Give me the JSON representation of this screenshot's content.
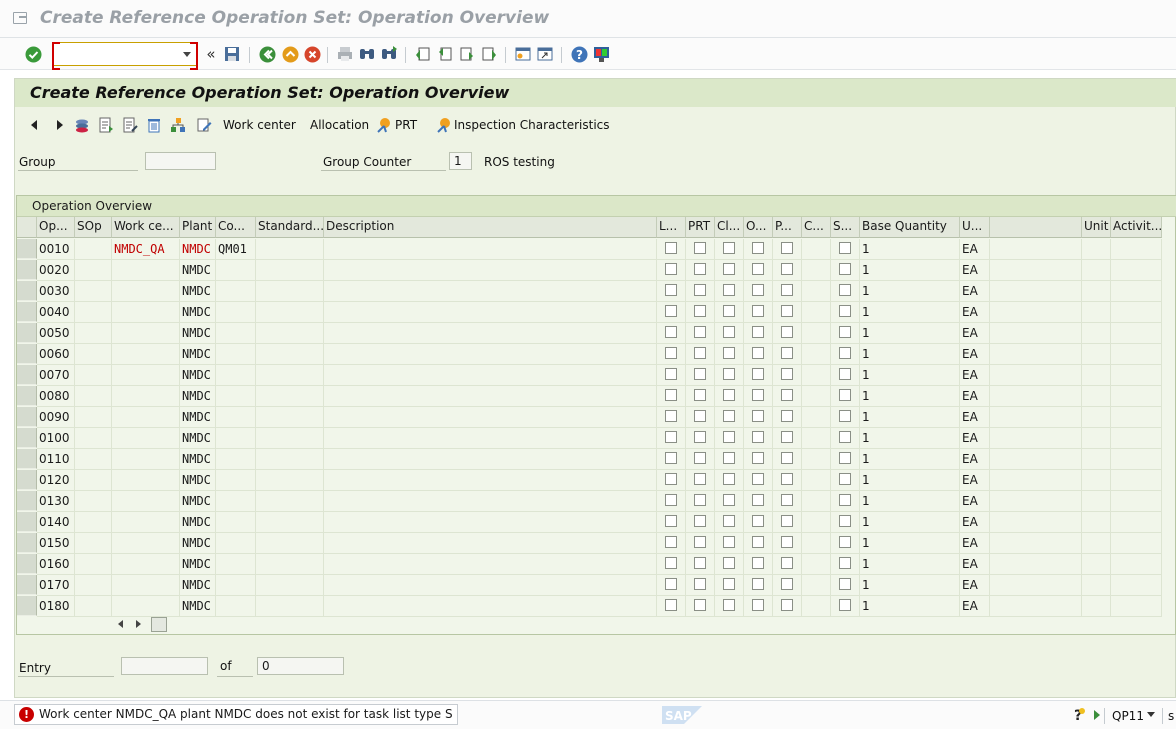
{
  "window": {
    "title": "Create Reference Operation Set: Operation Overview"
  },
  "toolbar": {
    "command_placeholder": ""
  },
  "screen": {
    "title": "Create Reference Operation Set: Operation Overview"
  },
  "app_toolbar": {
    "work_center": "Work center",
    "allocation": "Allocation",
    "prt": "PRT",
    "inspection": "Inspection Characteristics"
  },
  "header": {
    "group_label": "Group",
    "group_value": "",
    "group_counter_label": "Group Counter",
    "group_counter_value": "1",
    "description": "ROS testing"
  },
  "table": {
    "title": "Operation Overview",
    "columns": [
      "Op...",
      "SOp",
      "Work ce...",
      "Plant",
      "Co...",
      "Standard...",
      "Description",
      "L...",
      "PRT",
      "Cl...",
      "O...",
      "P...",
      "C...",
      "S...",
      "Base Quantity",
      "U...",
      "",
      "Unit",
      "Activit..."
    ],
    "rows": [
      {
        "op": "0010",
        "sop": "",
        "wc": "NMDC_QA",
        "plant": "NMDC",
        "co": "QM01",
        "base": "1",
        "un": "EA",
        "error": true
      },
      {
        "op": "0020",
        "sop": "",
        "wc": "",
        "plant": "NMDC",
        "co": "",
        "base": "1",
        "un": "EA"
      },
      {
        "op": "0030",
        "sop": "",
        "wc": "",
        "plant": "NMDC",
        "co": "",
        "base": "1",
        "un": "EA"
      },
      {
        "op": "0040",
        "sop": "",
        "wc": "",
        "plant": "NMDC",
        "co": "",
        "base": "1",
        "un": "EA"
      },
      {
        "op": "0050",
        "sop": "",
        "wc": "",
        "plant": "NMDC",
        "co": "",
        "base": "1",
        "un": "EA"
      },
      {
        "op": "0060",
        "sop": "",
        "wc": "",
        "plant": "NMDC",
        "co": "",
        "base": "1",
        "un": "EA"
      },
      {
        "op": "0070",
        "sop": "",
        "wc": "",
        "plant": "NMDC",
        "co": "",
        "base": "1",
        "un": "EA"
      },
      {
        "op": "0080",
        "sop": "",
        "wc": "",
        "plant": "NMDC",
        "co": "",
        "base": "1",
        "un": "EA"
      },
      {
        "op": "0090",
        "sop": "",
        "wc": "",
        "plant": "NMDC",
        "co": "",
        "base": "1",
        "un": "EA"
      },
      {
        "op": "0100",
        "sop": "",
        "wc": "",
        "plant": "NMDC",
        "co": "",
        "base": "1",
        "un": "EA"
      },
      {
        "op": "0110",
        "sop": "",
        "wc": "",
        "plant": "NMDC",
        "co": "",
        "base": "1",
        "un": "EA"
      },
      {
        "op": "0120",
        "sop": "",
        "wc": "",
        "plant": "NMDC",
        "co": "",
        "base": "1",
        "un": "EA"
      },
      {
        "op": "0130",
        "sop": "",
        "wc": "",
        "plant": "NMDC",
        "co": "",
        "base": "1",
        "un": "EA"
      },
      {
        "op": "0140",
        "sop": "",
        "wc": "",
        "plant": "NMDC",
        "co": "",
        "base": "1",
        "un": "EA"
      },
      {
        "op": "0150",
        "sop": "",
        "wc": "",
        "plant": "NMDC",
        "co": "",
        "base": "1",
        "un": "EA"
      },
      {
        "op": "0160",
        "sop": "",
        "wc": "",
        "plant": "NMDC",
        "co": "",
        "base": "1",
        "un": "EA"
      },
      {
        "op": "0170",
        "sop": "",
        "wc": "",
        "plant": "NMDC",
        "co": "",
        "base": "1",
        "un": "EA"
      },
      {
        "op": "0180",
        "sop": "",
        "wc": "",
        "plant": "NMDC",
        "co": "",
        "base": "1",
        "un": "EA"
      }
    ]
  },
  "entry": {
    "label": "Entry",
    "value": "",
    "of_label": "of",
    "total": "0"
  },
  "status": {
    "message": "Work center NMDC_QA plant NMDC does not exist for task list type S",
    "system": "QP11",
    "brand": "SAP"
  },
  "icons": {
    "ok": "check-icon",
    "save": "save-icon",
    "back": "back-icon",
    "exit": "exit-icon",
    "cancel": "cancel-icon",
    "print": "print-icon",
    "find": "find-icon",
    "find_next": "find-next-icon",
    "first_page": "first-page-icon",
    "prev_page": "previous-page-icon",
    "next_page": "next-page-icon",
    "last_page": "last-page-icon",
    "new_session": "new-session-icon",
    "shortcut": "shortcut-icon",
    "help": "help-icon",
    "layout": "customize-layout-icon"
  }
}
